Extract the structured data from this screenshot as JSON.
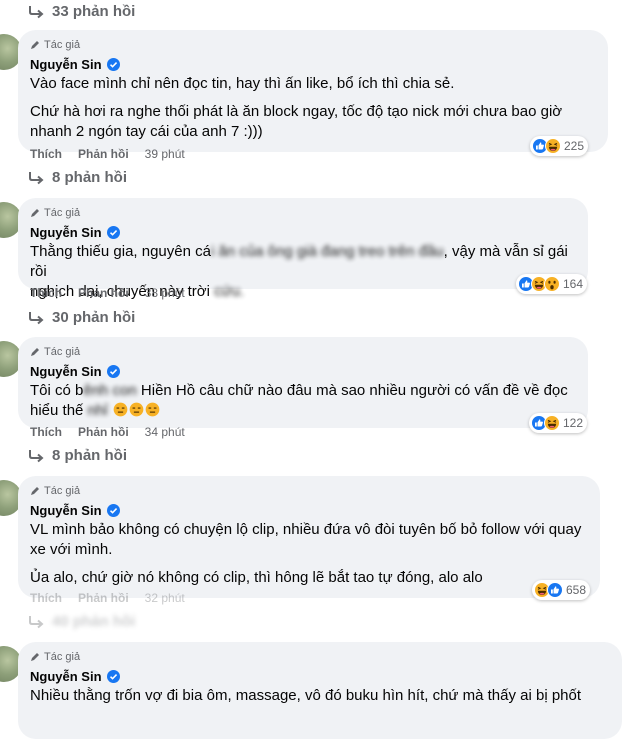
{
  "threads": [
    {
      "replies_label": "33 phản hồi"
    },
    {
      "badge": "Tác giả",
      "author": "Nguyễn Sin",
      "paragraphs": [
        "Vào face mình chỉ nên đọc tin, hay thì ấn like, bổ ích thì chia sẻ.",
        "Chứ hà hơi ra nghe thối phát là ăn block ngay, tốc độ tạo nick mới chưa bao giờ nhanh 2 ngón tay cái của anh 7 :)))"
      ],
      "like_label": "Thích",
      "reply_label": "Phản hồi",
      "time": "39 phút",
      "reaction_count": "225",
      "reaction_icons": [
        "like-reaction-icon",
        "haha-reaction-icon"
      ],
      "replies_label": "8 phản hồi"
    },
    {
      "badge": "Tác giả",
      "author": "Nguyễn Sin",
      "line1_a": "Thằng thiếu gia, nguyên cá",
      "line1_blur": "i ăn của ông già đang treo trên đầu",
      "line1_b": ", vậy mà vẫn sỉ gái rồi",
      "line2_a": "nghịch dại, chuyến này trời ",
      "line2_blur": "cứu.",
      "like_label": "Thích",
      "reply_label": "Phản hồi",
      "time": "38 phút",
      "reaction_count": "164",
      "reaction_icons": [
        "like-reaction-icon",
        "haha-reaction-icon",
        "wow-reaction-icon"
      ],
      "replies_label": "30 phản hồi"
    },
    {
      "badge": "Tác giả",
      "author": "Nguyễn Sin",
      "line1_a": "Tôi có b",
      "line1_blur": "ênh con",
      "line1_b": " Hiền Hồ câu chữ nào đâu mà sao nhiều người có vấn đề về đọc",
      "line2_a": "hiểu thế ",
      "line2_blur": "nhỉ",
      "like_label": "Thích",
      "reply_label": "Phản hồi",
      "time": "34 phút",
      "reaction_count": "122",
      "reaction_icons": [
        "like-reaction-icon",
        "haha-reaction-icon"
      ],
      "replies_label": "8 phản hồi"
    },
    {
      "badge": "Tác giả",
      "author": "Nguyễn Sin",
      "paragraphs": [
        "VL mình bảo không có chuyện lộ clip, nhiều đứa vô đòi tuyên bố bỏ follow với quay xe với mình.",
        "Ủa alo, chứ giờ nó không có clip, thì hông lẽ bắt tao tự đóng, alo alo"
      ],
      "like_label": "Thích",
      "reply_label": "Phản hồi",
      "time": "32 phút",
      "reaction_count": "658",
      "reaction_icons": [
        "haha-reaction-icon",
        "like-reaction-icon"
      ],
      "replies_label": "40 phản hồi"
    },
    {
      "badge": "Tác giả",
      "author": "Nguyễn Sin",
      "paragraphs": [
        "Nhiều thằng trốn vợ đi bia ôm, massage, vô đó buku hìn hít, chứ mà thấy ai bị phốt"
      ]
    }
  ],
  "colors": {
    "bubble": "#f0f2f5",
    "secondary_text": "#65676b",
    "like_blue": "#1877f2",
    "haha_yellow": "#f7b125"
  }
}
